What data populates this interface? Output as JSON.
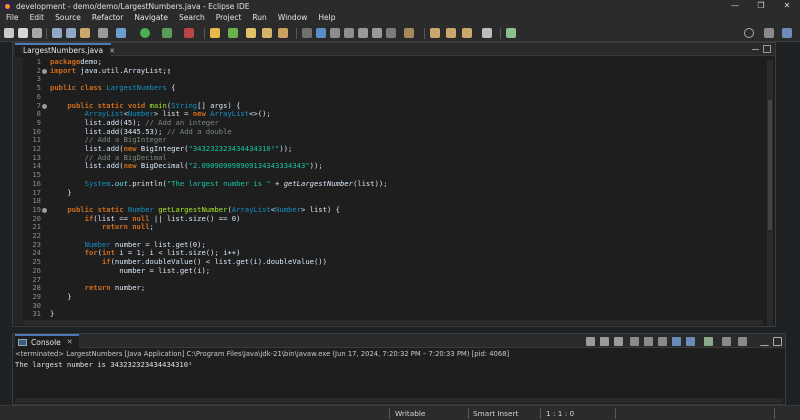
{
  "window": {
    "title": "development - demo/demo/LargestNumbers.java - Eclipse IDE",
    "min": "—",
    "max": "❐",
    "close": "✕"
  },
  "menu": [
    "File",
    "Edit",
    "Source",
    "Refactor",
    "Navigate",
    "Search",
    "Project",
    "Run",
    "Window",
    "Help"
  ],
  "editor": {
    "tab_label": "LargestNumbers.java",
    "tab_close": "✕"
  },
  "code_lines": [
    {
      "n": "1",
      "fold": false,
      "parts": [
        [
          "k",
          "package"
        ],
        [
          "",
          "demo;"
        ]
      ]
    },
    {
      "n": "2",
      "fold": true,
      "parts": [
        [
          "k",
          "import"
        ],
        [
          "",
          " java.util.ArrayList;▯"
        ]
      ]
    },
    {
      "n": "3",
      "fold": false,
      "parts": []
    },
    {
      "n": "5",
      "fold": false,
      "parts": [
        [
          "k",
          "public class"
        ],
        [
          "t",
          " LargestNumbers"
        ],
        [
          "",
          " {"
        ]
      ]
    },
    {
      "n": "6",
      "fold": false,
      "parts": []
    },
    {
      "n": "7",
      "fold": true,
      "parts": [
        [
          "",
          "    "
        ],
        [
          "k",
          "public static void"
        ],
        [
          "",
          " "
        ],
        [
          "m",
          "main"
        ],
        [
          "",
          "("
        ],
        [
          "t",
          "String"
        ],
        [
          "",
          "[] args) {"
        ]
      ]
    },
    {
      "n": "8",
      "fold": false,
      "parts": [
        [
          "",
          "        "
        ],
        [
          "t",
          "ArrayList"
        ],
        [
          "",
          "<"
        ],
        [
          "t",
          "Number"
        ],
        [
          "",
          "> list = "
        ],
        [
          "k",
          "new"
        ],
        [
          "",
          " "
        ],
        [
          "t",
          "ArrayList"
        ],
        [
          "",
          "<>();"
        ]
      ]
    },
    {
      "n": "9",
      "fold": false,
      "parts": [
        [
          "",
          "        list.add(45); "
        ],
        [
          "c",
          "// Add an integer"
        ]
      ]
    },
    {
      "n": "10",
      "fold": false,
      "parts": [
        [
          "",
          "        list.add(3445.53); "
        ],
        [
          "c",
          "// Add a double"
        ]
      ]
    },
    {
      "n": "11",
      "fold": false,
      "parts": [
        [
          "c",
          "        // Add a BigInteger"
        ]
      ]
    },
    {
      "n": "12",
      "fold": false,
      "parts": [
        [
          "",
          "        list.add("
        ],
        [
          "k",
          "new"
        ],
        [
          "",
          " BigInteger("
        ],
        [
          "s",
          "\"343232323434434310¹\""
        ],
        [
          "",
          "));"
        ]
      ]
    },
    {
      "n": "13",
      "fold": false,
      "parts": [
        [
          "c",
          "        // Add a BigDecimal"
        ]
      ]
    },
    {
      "n": "14",
      "fold": false,
      "parts": [
        [
          "",
          "        list.add("
        ],
        [
          "k",
          "new"
        ],
        [
          "",
          " BigDecimal("
        ],
        [
          "s",
          "\"2.090909098909134343334343\""
        ],
        [
          "",
          "));"
        ]
      ]
    },
    {
      "n": "15",
      "fold": false,
      "parts": []
    },
    {
      "n": "16",
      "fold": false,
      "parts": [
        [
          "",
          "        "
        ],
        [
          "t",
          "System"
        ],
        [
          ".",
          ""
        ],
        [
          "f i",
          "out"
        ],
        [
          "",
          ".println("
        ],
        [
          "s",
          "\"The largest number is \""
        ],
        [
          "",
          " + "
        ],
        [
          "i",
          "getLargestNumber"
        ],
        [
          "",
          "(list));"
        ]
      ]
    },
    {
      "n": "17",
      "fold": false,
      "parts": [
        [
          "",
          "    }"
        ]
      ]
    },
    {
      "n": "18",
      "fold": false,
      "parts": []
    },
    {
      "n": "19",
      "fold": true,
      "parts": [
        [
          "",
          "    "
        ],
        [
          "k",
          "public static"
        ],
        [
          "",
          " "
        ],
        [
          "t",
          "Number"
        ],
        [
          "",
          " "
        ],
        [
          "m",
          "getLargestNumber"
        ],
        [
          "",
          "("
        ],
        [
          "t",
          "ArrayList"
        ],
        [
          "",
          "<"
        ],
        [
          "t",
          "Number"
        ],
        [
          "",
          "> list) {"
        ]
      ]
    },
    {
      "n": "20",
      "fold": false,
      "parts": [
        [
          "",
          "        "
        ],
        [
          "k",
          "if"
        ],
        [
          "",
          "(list == "
        ],
        [
          "k",
          "null"
        ],
        [
          "",
          " || list.size() == 0)"
        ]
      ]
    },
    {
      "n": "21",
      "fold": false,
      "parts": [
        [
          "",
          "            "
        ],
        [
          "k",
          "return null"
        ],
        [
          "",
          ";"
        ]
      ]
    },
    {
      "n": "22",
      "fold": false,
      "parts": []
    },
    {
      "n": "23",
      "fold": false,
      "parts": [
        [
          "",
          "        "
        ],
        [
          "t",
          "Number"
        ],
        [
          "",
          " number = list.get(0);"
        ]
      ]
    },
    {
      "n": "24",
      "fold": false,
      "parts": [
        [
          "",
          "        "
        ],
        [
          "k",
          "for"
        ],
        [
          "",
          "("
        ],
        [
          "k",
          "int"
        ],
        [
          "",
          " i = 1; i < list.size(); i++)"
        ]
      ]
    },
    {
      "n": "25",
      "fold": false,
      "parts": [
        [
          "",
          "            "
        ],
        [
          "k",
          "if"
        ],
        [
          "",
          "(number.doubleValue() < list.get(i).doubleValue())"
        ]
      ]
    },
    {
      "n": "26",
      "fold": false,
      "parts": [
        [
          "",
          "                number = list.get(i);"
        ]
      ]
    },
    {
      "n": "27",
      "fold": false,
      "parts": []
    },
    {
      "n": "28",
      "fold": false,
      "parts": [
        [
          "",
          "        "
        ],
        [
          "k",
          "return"
        ],
        [
          "",
          " number;"
        ]
      ]
    },
    {
      "n": "29",
      "fold": false,
      "parts": [
        [
          "",
          "    }"
        ]
      ]
    },
    {
      "n": "30",
      "fold": false,
      "parts": []
    },
    {
      "n": "31",
      "fold": false,
      "parts": [
        [
          "",
          "}"
        ]
      ]
    },
    {
      "n": "32",
      "fold": false,
      "parts": []
    }
  ],
  "console": {
    "tab_label": "Console",
    "tab_close": "✕",
    "terminated": "<terminated> LargestNumbers [Java Application] C:\\Program Files\\Java\\jdk-21\\bin\\javaw.exe  (Jun 17, 2024, 7:20:32 PM – 7:20:33 PM) [pid: 4068]",
    "output": "The largest number is 343232323434434310¹"
  },
  "status": {
    "mode": "Writable",
    "insert": "Smart Insert",
    "position": "1 : 1 : 0"
  },
  "colors": {
    "keyword": "#cc6c1d",
    "type": "#1290c3",
    "string": "#17c6a3",
    "comment": "#7a8a7a",
    "accent": "#4d7ab5"
  }
}
